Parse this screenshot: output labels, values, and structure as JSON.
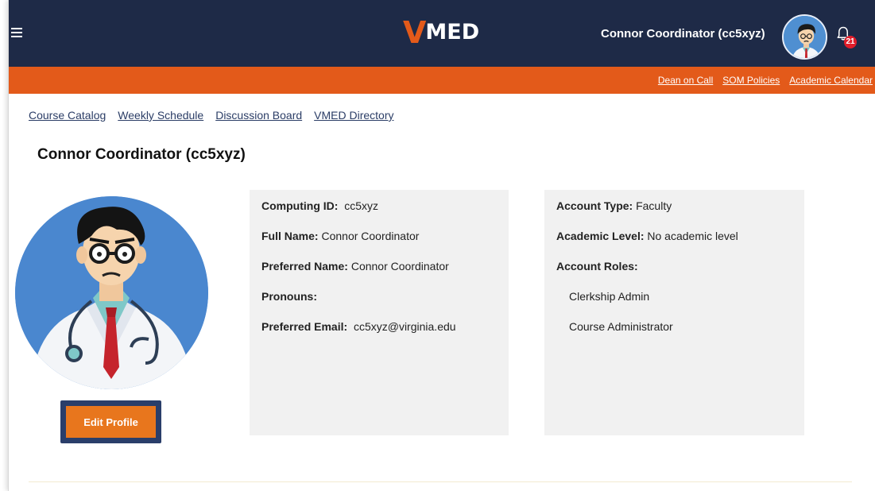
{
  "header": {
    "logo_v": "V",
    "logo_rest": "MED",
    "user_name": "Connor Coordinator (cc5xyz)",
    "notification_count": "21"
  },
  "top_links": [
    {
      "label": "Dean on Call"
    },
    {
      "label": "SOM Policies"
    },
    {
      "label": "Academic Calendar"
    }
  ],
  "nav": [
    {
      "label": "Course Catalog"
    },
    {
      "label": "Weekly Schedule"
    },
    {
      "label": "Discussion Board"
    },
    {
      "label": "VMED Directory"
    }
  ],
  "page_title": "Connor Coordinator (cc5xyz)",
  "edit_button": "Edit Profile",
  "profile": {
    "computing_id_label": "Computing ID:",
    "computing_id": "cc5xyz",
    "full_name_label": "Full Name:",
    "full_name": "Connor Coordinator",
    "preferred_name_label": "Preferred Name:",
    "preferred_name": "Connor Coordinator",
    "pronouns_label": "Pronouns:",
    "pronouns": "",
    "preferred_email_label": "Preferred Email:",
    "preferred_email": "cc5xyz@virginia.edu"
  },
  "account": {
    "type_label": "Account Type:",
    "type": "Faculty",
    "level_label": "Academic Level:",
    "level": "No academic level",
    "roles_label": "Account Roles:",
    "roles": [
      "Clerkship Admin",
      "Course Administrator"
    ]
  },
  "colors": {
    "navy": "#1e2a47",
    "orange": "#e35a1a",
    "button_orange": "#e8761d",
    "avatar_blue": "#4a87cf"
  }
}
